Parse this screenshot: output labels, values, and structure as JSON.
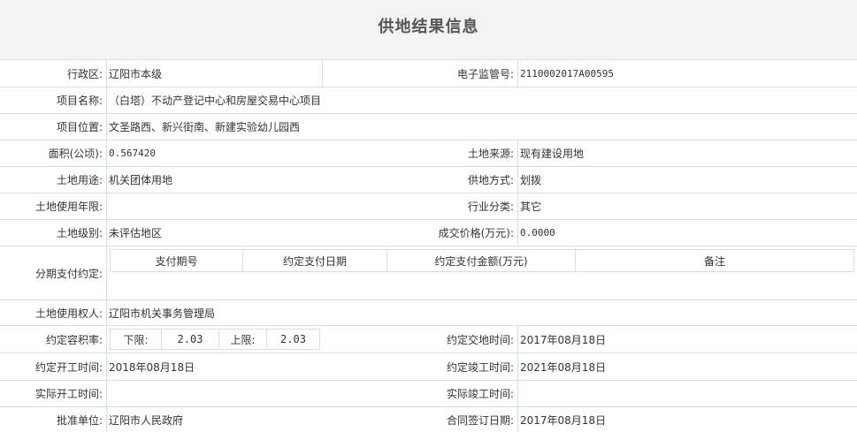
{
  "page": {
    "title": "供地结果信息"
  },
  "fields": {
    "district_label": "行政区:",
    "district_value": "辽阳市本级",
    "supervision_no_label": "电子监管号:",
    "supervision_no_value": "2110002017A00595",
    "project_name_label": "项目名称:",
    "project_name_value": "（白塔）不动产登记中心和房屋交易中心项目",
    "project_location_label": "项目位置:",
    "project_location_value": "文圣路西、新兴街南、新建实验幼儿园西",
    "area_label": "面积(公顷):",
    "area_value": "0.567420",
    "land_source_label": "土地来源:",
    "land_source_value": "现有建设用地",
    "land_use_label": "土地用途:",
    "land_use_value": "机关团体用地",
    "supply_method_label": "供地方式:",
    "supply_method_value": "划拨",
    "use_years_label": "土地使用年限:",
    "use_years_value": "",
    "industry_label": "行业分类:",
    "industry_value": "其它",
    "land_grade_label": "土地级别:",
    "land_grade_value": "未评估地区",
    "price_label": "成交价格(万元):",
    "price_value": "0.0000",
    "installment_label": "分期支付约定:",
    "installment_headers": [
      "支付期号",
      "约定支付日期",
      "约定支付金额(万元)",
      "备注"
    ],
    "land_user_label": "土地使用权人:",
    "land_user_value": "辽阳市机关事务管理局",
    "far_label": "约定容积率:",
    "far_lower_label": "下限:",
    "far_lower_value": "2.03",
    "far_upper_label": "上限:",
    "far_upper_value": "2.03",
    "handover_label": "约定交地时间:",
    "handover_value": "2017年08月18日",
    "start_label": "约定开工时间:",
    "start_value": "2018年08月18日",
    "completion_label": "约定竣工时间:",
    "completion_value": "2021年08月18日",
    "actual_start_label": "实际开工时间:",
    "actual_start_value": "",
    "actual_completion_label": "实际竣工时间:",
    "actual_completion_value": "",
    "approver_label": "批准单位:",
    "approver_value": "辽阳市人民政府",
    "contract_date_label": "合同签订日期:",
    "contract_date_value": "2017年08月18日"
  }
}
